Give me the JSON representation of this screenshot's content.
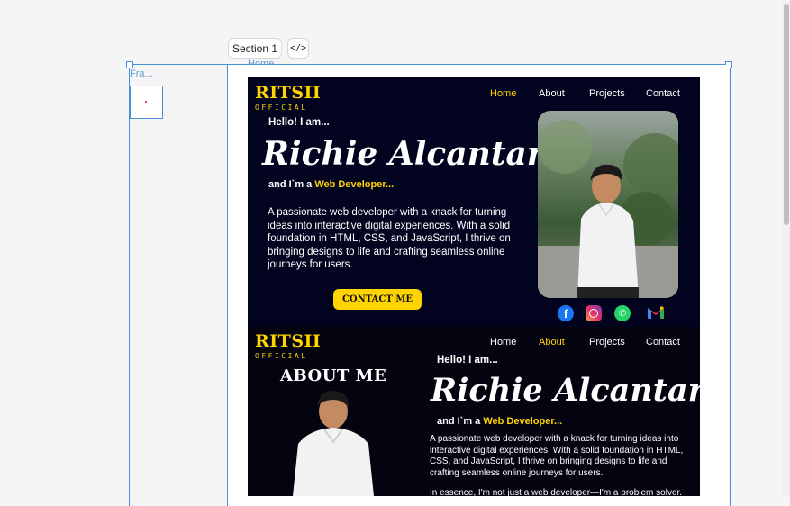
{
  "toolbar": {
    "section_label": "Section 1",
    "code_icon_glyph": "</>",
    "frame_label": "Fra...",
    "home_label": "Home"
  },
  "hero": {
    "logo_main": "RITSII",
    "logo_sub": "OFFICIAL",
    "nav": [
      "Home",
      "About",
      "Projects",
      "Contact"
    ],
    "active_nav": "Home",
    "greeting": "Hello!  I am...",
    "name": "Richie Alcantara",
    "role_prefix": "and I`m  a",
    "role": "Web Developer...",
    "description": "A passionate web developer with a knack for turning ideas into interactive digital experiences. With a solid foundation in HTML, CSS, and JavaScript, I thrive on bringing designs to life and crafting seamless online journeys for users.",
    "cta": "CONTACT ME",
    "social_icons": [
      "facebook-icon",
      "instagram-icon",
      "whatsapp-icon",
      "gmail-icon"
    ]
  },
  "about": {
    "logo_main": "RITSII",
    "logo_sub": "OFFICIAL",
    "nav": [
      "Home",
      "About",
      "Projects",
      "Contact"
    ],
    "active_nav": "About",
    "heading": "ABOUT ME",
    "greeting": "Hello!  I am...",
    "name": "Richie Alcantara",
    "role_prefix": "and I`m  a",
    "role": "Web Developer...",
    "description": "A passionate web developer with a knack for turning ideas into interactive digital experiences. With a solid foundation in HTML, CSS, and JavaScript, I thrive on bringing designs to life and crafting seamless online journeys for users.",
    "description2": "In essence, I'm not just a web developer—I'm a problem solver."
  },
  "colors": {
    "accent": "#ffd400",
    "hero_bg": "#02031f",
    "about_bg": "#03040f",
    "selection": "#4a90d9"
  }
}
